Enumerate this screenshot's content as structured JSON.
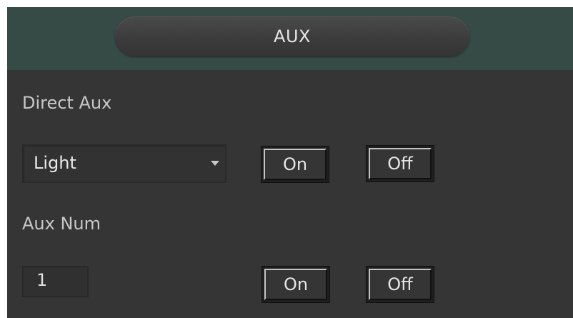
{
  "header": {
    "title": "AUX"
  },
  "direct_aux": {
    "label": "Direct Aux",
    "select_value": "Light",
    "on_label": "On",
    "off_label": "Off"
  },
  "aux_num": {
    "label": "Aux Num",
    "value": "1",
    "on_label": "On",
    "off_label": "Off"
  },
  "colors": {
    "header_bg": "#364a46",
    "panel_bg": "#353535",
    "text": "#c8c8c8"
  }
}
